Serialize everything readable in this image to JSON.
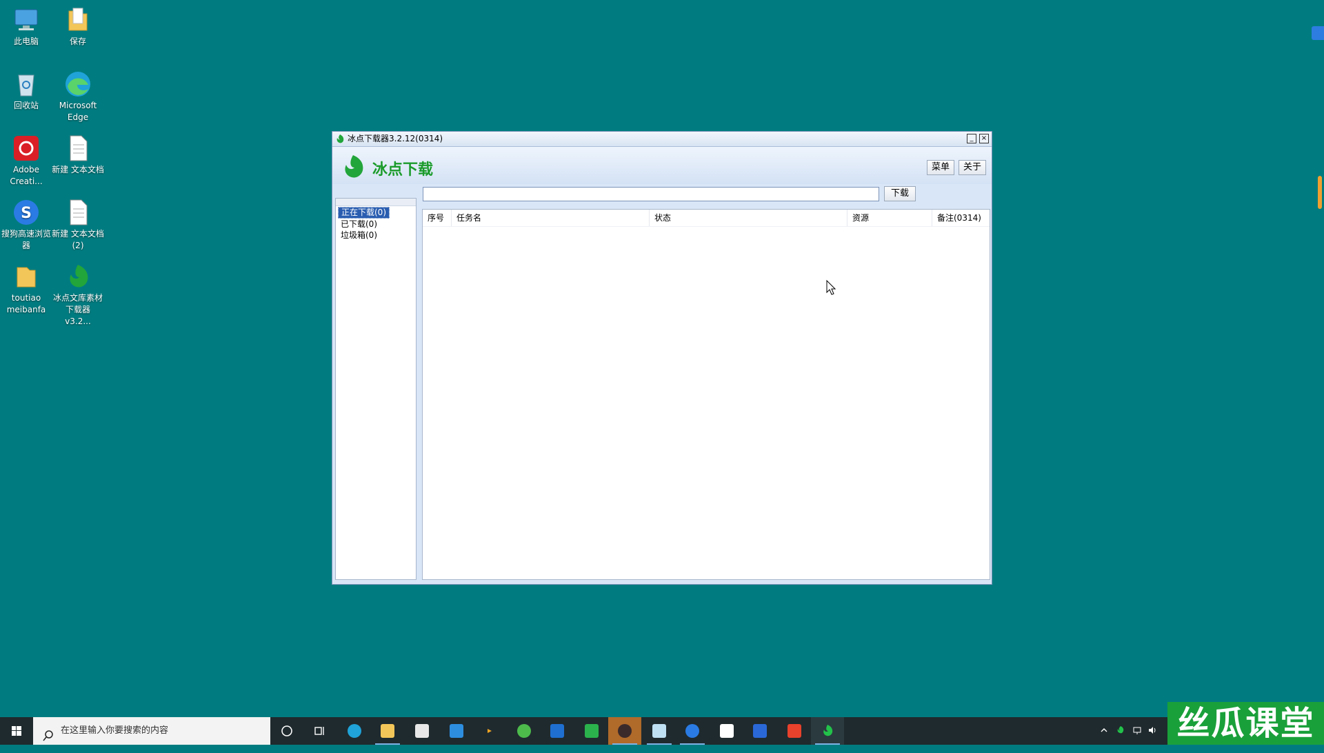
{
  "desktop": {
    "icons": [
      {
        "label": "此电脑"
      },
      {
        "label": "保存"
      },
      {
        "label": "回收站"
      },
      {
        "label": "Microsoft Edge"
      },
      {
        "label": "Adobe Creati..."
      },
      {
        "label": "新建 文本文档"
      },
      {
        "label": "搜狗高速浏览器"
      },
      {
        "label": "新建 文本文档 (2)"
      },
      {
        "label": "toutiao meibanfa"
      },
      {
        "label": "冰点文库素材下载器 v3.2..."
      }
    ]
  },
  "window": {
    "title": "冰点下载器3.2.12(0314)",
    "brand": "冰点下载",
    "menu_label": "菜单",
    "about_label": "关于",
    "download_label": "下载",
    "url_value": "",
    "sidebar": [
      {
        "label": "正在下载(0)",
        "selected": true
      },
      {
        "label": "已下载(0)",
        "selected": false
      },
      {
        "label": "垃圾箱(0)",
        "selected": false
      }
    ],
    "columns": [
      "序号",
      "任务名",
      "状态",
      "资源",
      "备注(0314)"
    ]
  },
  "taskbar": {
    "search_placeholder": "在这里输入你要搜索的内容"
  },
  "watermark": "丝瓜课堂",
  "colors": {
    "desktop": "#007c80",
    "accent_green": "#1a9b2a",
    "selection": "#2a5db0"
  }
}
